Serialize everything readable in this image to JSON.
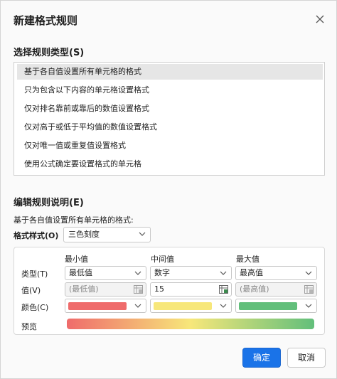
{
  "dialog": {
    "title": "新建格式规则",
    "select_rule_type_label": "选择规则类型(S)",
    "rule_types": [
      "基于各自值设置所有单元格的格式",
      "只为包含以下内容的单元格设置格式",
      "仅对排名靠前或靠后的数值设置格式",
      "仅对高于或低于平均值的数值设置格式",
      "仅对唯一值或重复值设置格式",
      "使用公式确定要设置格式的单元格"
    ],
    "selected_rule_index": 0,
    "edit_rule_label": "编辑规则说明(E)",
    "description": "基于各自值设置所有单元格的格式:",
    "format_style_label": "格式样式(O)",
    "format_style_value": "三色刻度",
    "columns": {
      "min": "最小值",
      "mid": "中间值",
      "max": "最大值"
    },
    "rows": {
      "type": "类型(T)",
      "value": "值(V)",
      "color": "颜色(C)",
      "preview": "预览"
    },
    "min": {
      "type": "最低值",
      "value_placeholder": "(最低值)",
      "color": "#ef6b6b"
    },
    "mid": {
      "type": "数字",
      "value": "15",
      "color": "#f7e77a"
    },
    "max": {
      "type": "最高值",
      "value_placeholder": "(最高值)",
      "color": "#62bf7b"
    },
    "ok_label": "确定",
    "cancel_label": "取消",
    "icons": {
      "close": "close-icon",
      "chevron": "chevron-down-icon",
      "cell_ref": "cell-reference-icon"
    }
  }
}
